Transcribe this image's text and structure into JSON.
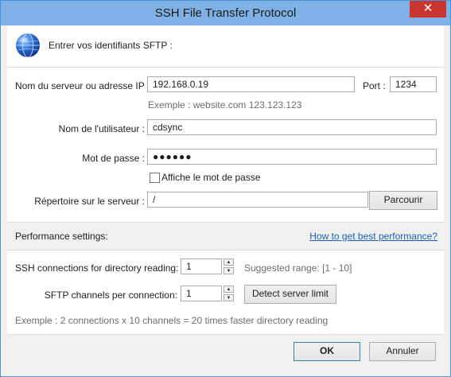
{
  "window": {
    "title": "SSH File Transfer Protocol",
    "close": "✕"
  },
  "header": {
    "text": "Entrer vos identifiants SFTP :",
    "icon": "globe-icon"
  },
  "server": {
    "label": "Nom du serveur ou adresse IP :",
    "value": "192.168.0.19",
    "port_label": "Port :",
    "port_value": "1234",
    "example": "Exemple :  website.com   123.123.123"
  },
  "user": {
    "label": "Nom de l'utilisateur :",
    "value": "cdsync"
  },
  "password": {
    "label": "Mot de passe :",
    "value": "●●●●●●",
    "show_label": "Affiche le mot de passe",
    "show_checked": false
  },
  "directory": {
    "label": "Répertoire sur le serveur :",
    "value": "/",
    "browse": "Parcourir"
  },
  "performance": {
    "title": "Performance settings:",
    "help_link": "How to get best performance?",
    "ssh_label": "SSH connections for directory reading:",
    "ssh_value": "1",
    "range": "Suggested range: [1 - 10]",
    "sftp_label": "SFTP channels per connection:",
    "sftp_value": "1",
    "detect": "Detect server limit",
    "example": "Exemple :  2 connections x 10 channels = 20 times faster directory reading"
  },
  "footer": {
    "ok": "OK",
    "cancel": "Annuler"
  },
  "colors": {
    "titlebar": "#7fb1e6",
    "close": "#c7372f",
    "link": "#1a5fb4"
  }
}
